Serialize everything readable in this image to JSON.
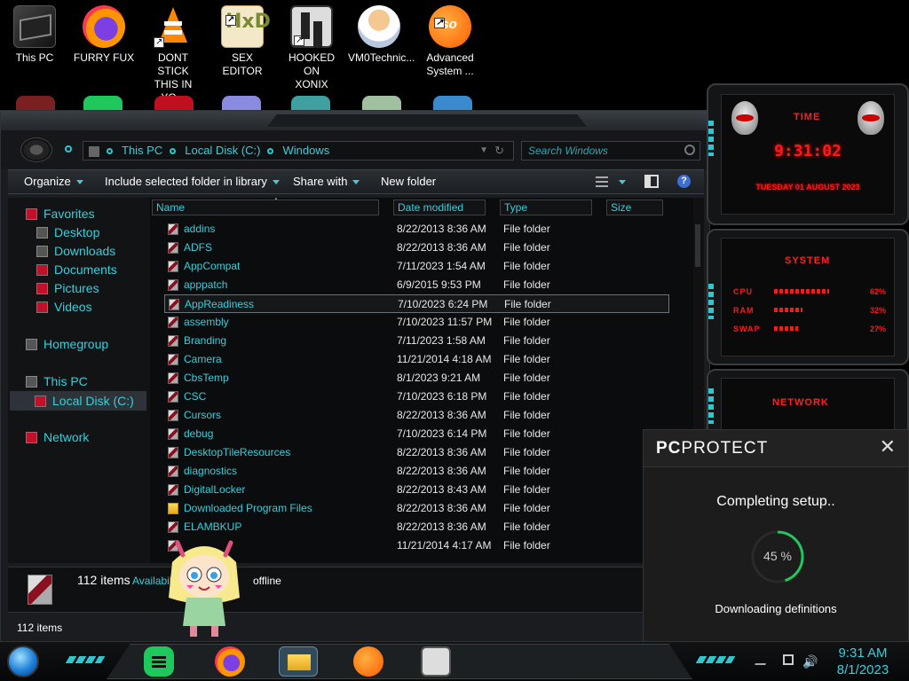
{
  "desktop": {
    "icons": [
      {
        "label": "This PC",
        "icon": "this-pc-icon"
      },
      {
        "label": "FURRY FUX",
        "icon": "firefox-icon"
      },
      {
        "label": "DONT STICK\nTHIS IN YO...",
        "icon": "vlc-icon"
      },
      {
        "label": "SEX EDITOR",
        "icon": "hxd-icon"
      },
      {
        "label": "HOOKED ON\nXONIX",
        "icon": "game-icon"
      },
      {
        "label": "VM0Technic...",
        "icon": "doctor-icon"
      },
      {
        "label": "Advanced\nSystem ...",
        "icon": "aso-icon"
      }
    ]
  },
  "explorer": {
    "breadcrumb": [
      "This PC",
      "Local Disk (C:)",
      "Windows"
    ],
    "search_placeholder": "Search Windows",
    "toolbar": {
      "organize": "Organize",
      "include": "Include selected folder in library",
      "share": "Share with",
      "new_folder": "New folder",
      "help": "?"
    },
    "nav": {
      "favorites": "Favorites",
      "desktop": "Desktop",
      "downloads": "Downloads",
      "documents": "Documents",
      "pictures": "Pictures",
      "videos": "Videos",
      "homegroup": "Homegroup",
      "this_pc": "This PC",
      "local_disk": "Local Disk (C:)",
      "network": "Network"
    },
    "columns": {
      "name": "Name",
      "date": "Date modified",
      "type": "Type",
      "size": "Size"
    },
    "files": [
      {
        "name": "addins",
        "date": "8/22/2013 8:36 AM",
        "type": "File folder"
      },
      {
        "name": "ADFS",
        "date": "8/22/2013 8:36 AM",
        "type": "File folder"
      },
      {
        "name": "AppCompat",
        "date": "7/11/2023 1:54 AM",
        "type": "File folder"
      },
      {
        "name": "apppatch",
        "date": "6/9/2015 9:53 PM",
        "type": "File folder"
      },
      {
        "name": "AppReadiness",
        "date": "7/10/2023 6:24 PM",
        "type": "File folder",
        "selected": true
      },
      {
        "name": "assembly",
        "date": "7/10/2023 11:57 PM",
        "type": "File folder"
      },
      {
        "name": "Branding",
        "date": "7/11/2023 1:58 AM",
        "type": "File folder"
      },
      {
        "name": "Camera",
        "date": "11/21/2014 4:18 AM",
        "type": "File folder"
      },
      {
        "name": "CbsTemp",
        "date": "8/1/2023 9:21 AM",
        "type": "File folder"
      },
      {
        "name": "CSC",
        "date": "7/10/2023 6:18 PM",
        "type": "File folder"
      },
      {
        "name": "Cursors",
        "date": "8/22/2013 8:36 AM",
        "type": "File folder"
      },
      {
        "name": "debug",
        "date": "7/10/2023 6:14 PM",
        "type": "File folder"
      },
      {
        "name": "DesktopTileResources",
        "date": "8/22/2013 8:36 AM",
        "type": "File folder"
      },
      {
        "name": "diagnostics",
        "date": "8/22/2013 8:36 AM",
        "type": "File folder"
      },
      {
        "name": "DigitalLocker",
        "date": "8/22/2013 8:43 AM",
        "type": "File folder"
      },
      {
        "name": "Downloaded Program Files",
        "date": "8/22/2013 8:36 AM",
        "type": "File folder",
        "yellow": true
      },
      {
        "name": "ELAMBKUP",
        "date": "8/22/2013 8:36 AM",
        "type": "File folder"
      },
      {
        "name": "",
        "date": "11/21/2014 4:17 AM",
        "type": "File folder"
      }
    ],
    "details": {
      "items": "112 items",
      "availability": "Availabili",
      "offline": "offline"
    },
    "status": "112 items"
  },
  "gadgets": {
    "time_title": "TIME",
    "clock": "9:31:02",
    "longdate": "TUESDAY 01 AUGUST 2023",
    "system_title": "SYSTEM",
    "stats": [
      {
        "label": "CPU",
        "value": "62%",
        "level": 0.62
      },
      {
        "label": "RAM",
        "value": "32%",
        "level": 0.32
      },
      {
        "label": "SWAP",
        "value": "27%",
        "level": 0.27
      }
    ],
    "network_title": "NETWORK"
  },
  "pcprotect": {
    "brand_bold": "PC",
    "brand_rest": "PROTECT",
    "close": "✕",
    "message": "Completing setup..",
    "percent_text": "45 %",
    "progress": 0.45,
    "subtext": "Downloading definitions"
  },
  "taskbar": {
    "time": "9:31 AM",
    "date": "8/1/2023"
  },
  "colors": {
    "accent": "#35d0dc",
    "alert": "#ff1818",
    "progress": "#22c55e"
  }
}
